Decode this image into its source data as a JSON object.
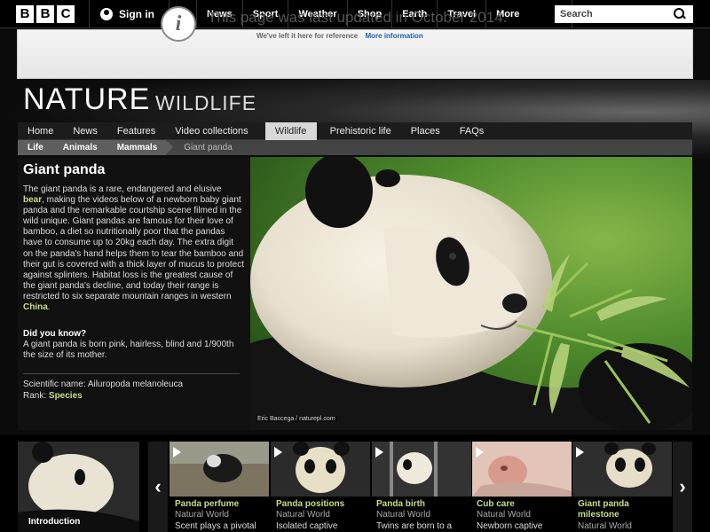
{
  "topbar": {
    "logo_letters": [
      "B",
      "B",
      "C"
    ],
    "signin": "Sign in",
    "nav": [
      "News",
      "Sport",
      "Weather",
      "Shop",
      "Earth",
      "Travel"
    ],
    "more": "More",
    "search_placeholder": "Search"
  },
  "notice": {
    "title": "This page was last updated in October 2014.",
    "sub": "We've left it here for reference",
    "link": "More information"
  },
  "header": {
    "title": "NATURE",
    "subtitle": "WILDLIFE"
  },
  "section_nav": [
    "Home",
    "News",
    "Features",
    "Video collections",
    "Wildlife",
    "Prehistoric life",
    "Places",
    "FAQs"
  ],
  "breadcrumb": [
    "Life",
    "Animals",
    "Mammals",
    "Giant panda"
  ],
  "species": {
    "name": "Giant panda",
    "desc_1": "The giant panda is a rare, endangered and elusive ",
    "desc_link_bear": "bear",
    "desc_2": ", making the videos below of a newborn baby giant panda and the remarkable courtship scene filmed in the wild unique. Giant pandas are famous for their love of bamboo, a diet so nutritionally poor that the pandas have to consume up to 20kg each day. The extra digit on the panda's hand helps them to tear the bamboo and their gut is covered with a thick layer of mucus to protect against splinters. Habitat loss is the greatest cause of the giant panda's decline, and today their range is restricted to six separate mountain ranges in western ",
    "desc_link_china": "China",
    "desc_3": ".",
    "dyk_title": "Did you know?",
    "dyk_text": "A giant panda is born pink, hairless, blind and 1/900th the size of its mother.",
    "sci_label": "Scientific name: ",
    "sci_value": "Ailuropoda melanoleuca",
    "rank_label": "Rank: ",
    "rank_value": "Species"
  },
  "photo_credit": "Eric Baccega / naturepl.com",
  "carousel": {
    "intro": "Introduction",
    "prev": "‹",
    "next": "›",
    "videos": [
      {
        "title": "Panda perfume",
        "source": "Natural World",
        "desc": "Scent plays a pivotal"
      },
      {
        "title": "Panda positions",
        "source": "Natural World",
        "desc": "Isolated captive"
      },
      {
        "title": "Panda birth",
        "source": "Natural World",
        "desc": "Twins are born to a"
      },
      {
        "title": "Cub care",
        "source": "Natural World",
        "desc": "Newborn captive"
      },
      {
        "title": "Giant panda milestone",
        "source": "Natural World",
        "desc": ""
      }
    ]
  },
  "colors": {
    "accent_green": "#c8dd8a",
    "link_blue": "#1f5fa6"
  }
}
